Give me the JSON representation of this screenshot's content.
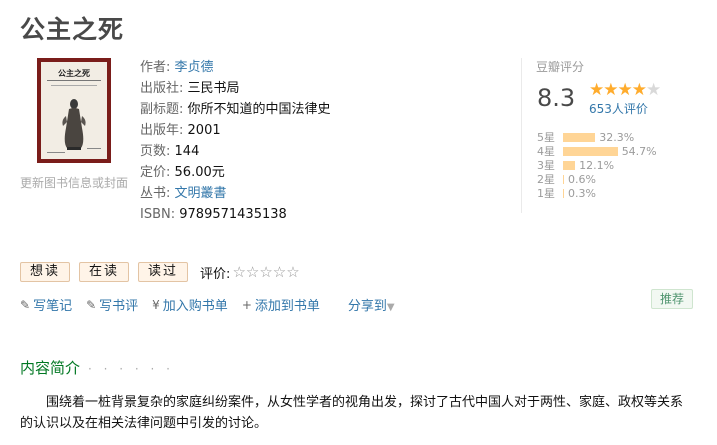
{
  "book": {
    "title": "公主之死",
    "update_link": "更新图书信息或封面",
    "cover_title": "公主之死",
    "info": [
      {
        "label": "作者:",
        "value": "李贞德",
        "link": true
      },
      {
        "label": "出版社:",
        "value": "三民书局",
        "link": false
      },
      {
        "label": "副标题:",
        "value": "你所不知道的中国法律史",
        "link": false
      },
      {
        "label": "出版年:",
        "value": "2001",
        "link": false
      },
      {
        "label": "页数:",
        "value": "144",
        "link": false
      },
      {
        "label": "定价:",
        "value": "56.00元",
        "link": false
      },
      {
        "label": "丛书:",
        "value": "文明叢書",
        "link": true
      },
      {
        "label": "ISBN:",
        "value": "9789571435138",
        "link": false
      }
    ]
  },
  "rating": {
    "header": "豆瓣评分",
    "score": "8.3",
    "stars_filled": 4,
    "votes": "653人评价",
    "distribution": [
      {
        "label": "5星",
        "percent": 32.3,
        "text": "32.3%"
      },
      {
        "label": "4星",
        "percent": 54.7,
        "text": "54.7%"
      },
      {
        "label": "3星",
        "percent": 12.1,
        "text": "12.1%"
      },
      {
        "label": "2星",
        "percent": 0.6,
        "text": "0.6%"
      },
      {
        "label": "1星",
        "percent": 0.3,
        "text": "0.3%"
      }
    ]
  },
  "buttons": {
    "want": "想读",
    "reading": "在读",
    "read": "读过",
    "rate_label": "评价:"
  },
  "actions": {
    "write_note": "写笔记",
    "write_review": "写书评",
    "add_cart": "加入购书单",
    "add_list": "添加到书单",
    "share": "分享到",
    "recommend": "推荐"
  },
  "intro": {
    "header": "内容简介",
    "dots": "· · · · · ·",
    "text": "围绕着一桩背景复杂的家庭纠纷案件，从女性学者的视角出发，探讨了古代中国人对于两性、家庭、政权等关系的认识以及在相关法律问题中引发的讨论。"
  },
  "colors": {
    "link": "#3377aa",
    "star": "#ffac2d",
    "bar": "#ffd596",
    "section_green": "#007722"
  }
}
